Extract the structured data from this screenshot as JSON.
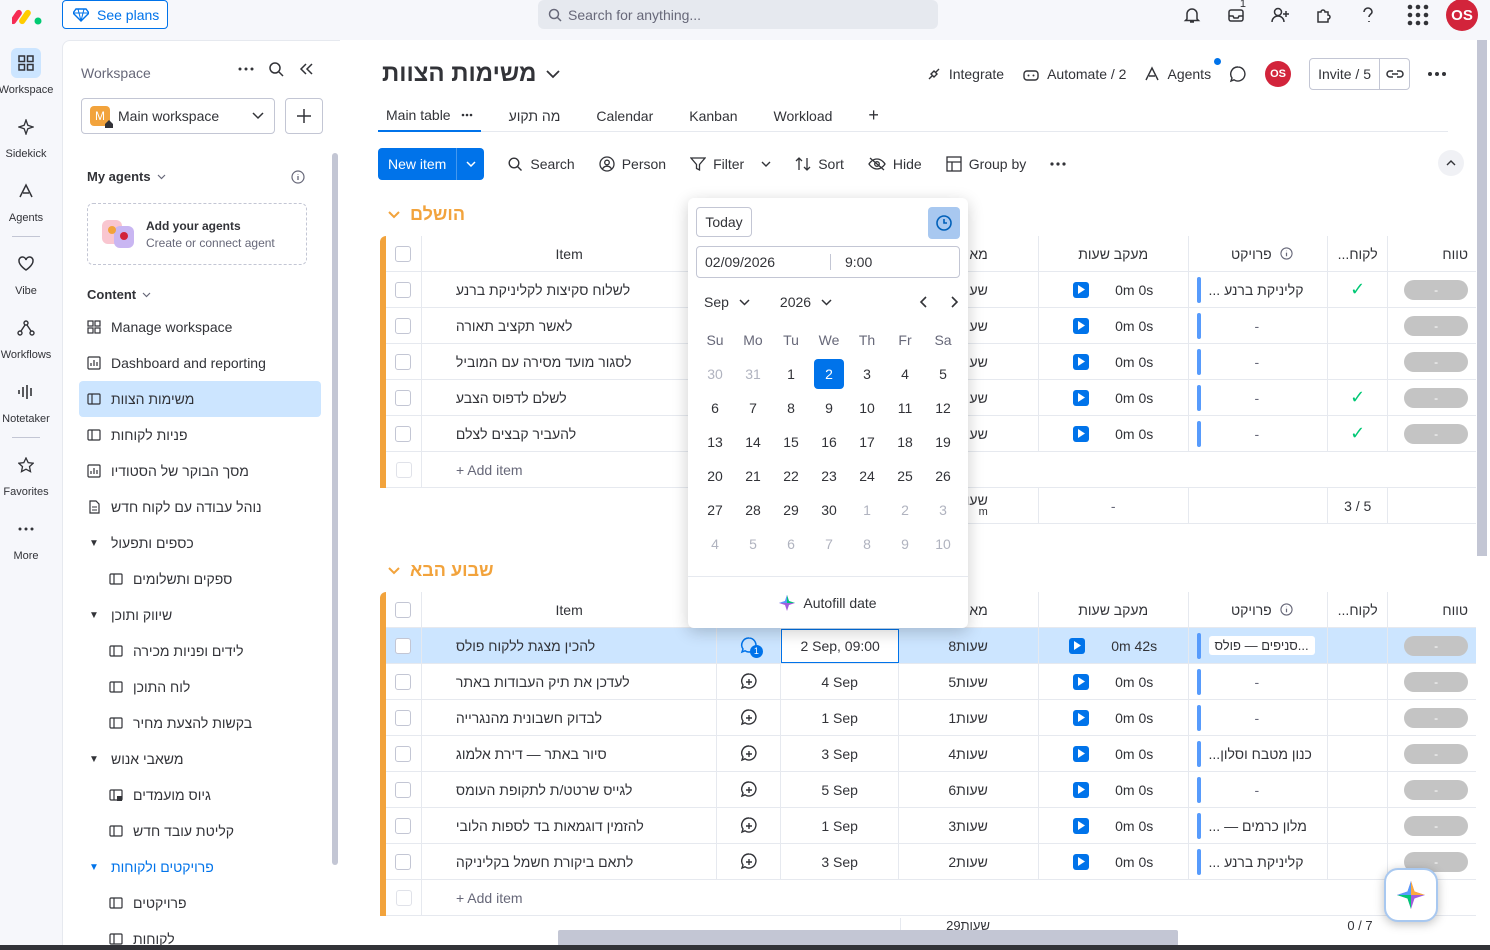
{
  "topbar": {
    "see_plans": "See plans",
    "search_placeholder": "Search for anything...",
    "inbox_count": "1",
    "avatar_initials": "OS"
  },
  "rail": {
    "workspace": "Workspace",
    "sidekick": "Sidekick",
    "agents": "Agents",
    "vibe": "Vibe",
    "workflows": "Workflows",
    "notetaker": "Notetaker",
    "favorites": "Favorites",
    "more": "More"
  },
  "sidebar": {
    "header": "Workspace",
    "workspace_name": "Main workspace",
    "workspace_letter": "M",
    "my_agents": "My agents",
    "add_agents_title": "Add your agents",
    "add_agents_sub": "Create or connect agent",
    "content": "Content",
    "items": [
      {
        "label": "Manage workspace"
      },
      {
        "label": "Dashboard and reporting"
      },
      {
        "label": "משימות הצוות"
      },
      {
        "label": "פניות לקוחות"
      },
      {
        "label": "מסך הבוקר של הסטודיו"
      },
      {
        "label": "נוהל עבודה עם לקוח חדש"
      },
      {
        "label": "כספים ותפעול"
      },
      {
        "label": "ספקים ותשלומים"
      },
      {
        "label": "שיווק ותוכן"
      },
      {
        "label": "לידים ופניות מכירה"
      },
      {
        "label": "לוח התוכן"
      },
      {
        "label": "בקשות להצעת מחיר"
      },
      {
        "label": "משאבי אנוש"
      },
      {
        "label": "גיוס מועמדים"
      },
      {
        "label": "קליטת עובד חדש"
      },
      {
        "label": "פרויקטים ולקוחות"
      },
      {
        "label": "פרויקטים"
      },
      {
        "label": "לקוחות"
      }
    ]
  },
  "board": {
    "title": "משימות הצוות",
    "integrate": "Integrate",
    "automate": "Automate / 2",
    "agents": "Agents",
    "avatar_initials": "OS",
    "invite": "Invite / 5",
    "tabs": [
      "Main table",
      "מה תקוע",
      "Calendar",
      "Kanban",
      "Workload"
    ],
    "add_tab": "+"
  },
  "toolbar": {
    "new_item": "New item",
    "search": "Search",
    "person": "Person",
    "filter": "Filter",
    "sort": "Sort",
    "hide": "Hide",
    "group_by": "Group by"
  },
  "columns": {
    "item": "Item",
    "hours": "מא",
    "tracking": "מעקב שעות",
    "project": "פרויקט",
    "client": "...לקוח",
    "status": "טווח"
  },
  "group1": {
    "title": "הושלם",
    "rows": [
      {
        "item": "לשלוח סקיצות לקליניקת ברנע",
        "hours": "שע",
        "track": "0m 0s",
        "project": "... קליניקת ברנע",
        "client_check": "✓",
        "status": "-"
      },
      {
        "item": "לאשר תקציב תאורה",
        "hours": "שע",
        "track": "0m 0s",
        "project": "-",
        "client_check": "",
        "status": "-"
      },
      {
        "item": "לסגור מועד מסירה עם המוביל",
        "hours": "שע",
        "track": "0m 0s",
        "project": "-",
        "client_check": "",
        "status": "-"
      },
      {
        "item": "לשלם לדפוס הצבע",
        "hours": "שע",
        "track": "0m 0s",
        "project": "-",
        "client_check": "✓",
        "status": "-"
      },
      {
        "item": "להעביר קבצים לצלם",
        "hours": "שע",
        "track": "0m 0s",
        "project": "-",
        "client_check": "✓",
        "status": "-"
      }
    ],
    "add_item": "+ Add item",
    "summary_hours": "שעו",
    "summary_hours_sub": "m",
    "summary_track": "-",
    "summary_client": "3 / 5"
  },
  "group2": {
    "title": "שבוע הבא",
    "rows": [
      {
        "item": "להכין מצגת ללקוח פולס",
        "update_count": "1",
        "date": "2 Sep, 09:00",
        "hours": "8שעות",
        "track": "0m 42s",
        "project": "סניפים — פולס..."
      },
      {
        "item": "לעדכן את תיק העבודות באתר",
        "update_count": "",
        "date": "4 Sep",
        "hours": "5שעות",
        "track": "0m 0s",
        "project": "-"
      },
      {
        "item": "לבדוק חשבונית מהנגרייה",
        "update_count": "",
        "date": "1 Sep",
        "hours": "1שעות",
        "track": "0m 0s",
        "project": "-"
      },
      {
        "item": "סיור באתר — דירת אלמוג",
        "update_count": "",
        "date": "3 Sep",
        "hours": "4שעות",
        "track": "0m 0s",
        "project": "...כנון מטבח וסלון"
      },
      {
        "item": "לגייס שרטט/ת לתקופת העומס",
        "update_count": "",
        "date": "5 Sep",
        "hours": "6שעות",
        "track": "0m 0s",
        "project": "-"
      },
      {
        "item": "להזמין דוגמאות בד לספות הלובי",
        "update_count": "",
        "date": "1 Sep",
        "hours": "3שעות",
        "track": "0m 0s",
        "project": "... — מלון כרמים"
      },
      {
        "item": "לתאם ביקורת חשמל בקליניקה",
        "update_count": "",
        "date": "3 Sep",
        "hours": "2שעות",
        "track": "0m 0s",
        "project": "... קליניקת ברנע"
      }
    ],
    "add_item": "+ Add item",
    "summary_hours": "29שעות",
    "summary_client": "0 / 7"
  },
  "datepicker": {
    "today": "Today",
    "date_value": "02/09/2026",
    "time_value": "9:00",
    "month": "Sep",
    "year": "2026",
    "dow": [
      "Su",
      "Mo",
      "Tu",
      "We",
      "Th",
      "Fr",
      "Sa"
    ],
    "weeks": [
      [
        "30",
        "31",
        "1",
        "2",
        "3",
        "4",
        "5"
      ],
      [
        "6",
        "7",
        "8",
        "9",
        "10",
        "11",
        "12"
      ],
      [
        "13",
        "14",
        "15",
        "16",
        "17",
        "18",
        "19"
      ],
      [
        "20",
        "21",
        "22",
        "23",
        "24",
        "25",
        "26"
      ],
      [
        "27",
        "28",
        "29",
        "30",
        "1",
        "2",
        "3"
      ],
      [
        "4",
        "5",
        "6",
        "7",
        "8",
        "9",
        "10"
      ]
    ],
    "selected_day": "2",
    "autofill": "Autofill date"
  },
  "colors": {
    "accent": "#0073ea",
    "group": "#f2a33c",
    "done": "#00c875"
  }
}
